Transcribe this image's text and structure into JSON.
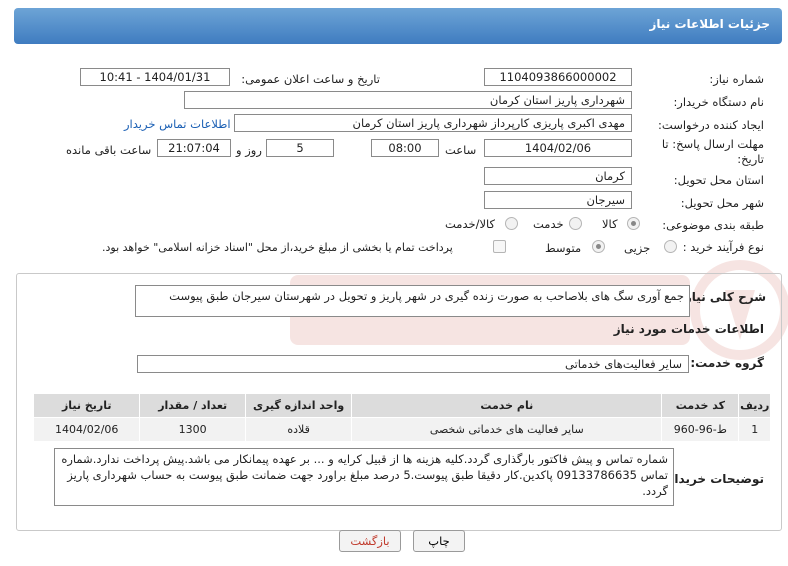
{
  "header": {
    "title": "جزئیات اطلاعات نیاز"
  },
  "form": {
    "need_number_label": "شماره نیاز:",
    "need_number": "1104093866000002",
    "announce_label": "تاریخ و ساعت اعلان عمومی:",
    "announce_value": "1404/01/31 - 10:41",
    "buyer_org_label": "نام دستگاه خریدار:",
    "buyer_org": "شهرداری پاریز استان کرمان",
    "creator_label": "ایجاد کننده درخواست:",
    "creator": "مهدی اکبری پاریزی کارپرداز شهرداری پاریز استان کرمان",
    "contact_link": "اطلاعات تماس خریدار",
    "deadline_label": "مهلت ارسال پاسخ: تا تاریخ:",
    "deadline_date": "1404/02/06",
    "time_label": "ساعت",
    "deadline_time": "08:00",
    "days_value": "5",
    "days_label": "روز و",
    "remaining_time": "21:07:04",
    "remaining_label": "ساعت باقی مانده",
    "province_label": "استان محل تحویل:",
    "province": "کرمان",
    "city_label": "شهر محل تحویل:",
    "city": "سیرجان",
    "category_label": "طبقه بندی موضوعی:",
    "category_options": [
      "کالا",
      "خدمت",
      "کالا/خدمت"
    ],
    "process_label": "نوع فرآیند خرید :",
    "process_options": [
      "جزیی",
      "متوسط"
    ],
    "payment_note": "پرداخت تمام یا بخشی از مبلغ خرید،از محل \"اسناد خزانه اسلامی\" خواهد بود."
  },
  "details": {
    "summary_label": "شرح کلی نیاز:",
    "summary": "جمع آوری سگ های بلاصاحب به صورت زنده گیری در شهر پاریز و تحویل در شهرستان سیرجان طبق پیوست",
    "services_title": "اطلاعات خدمات مورد نیاز",
    "service_group_label": "گروه خدمت:",
    "service_group": "سایر فعالیت‌های خدماتی",
    "table": {
      "headers": [
        "ردیف",
        "کد خدمت",
        "نام خدمت",
        "واحد اندازه گیری",
        "تعداد / مقدار",
        "تاریخ نیاز"
      ],
      "rows": [
        [
          "1",
          "ط-96-960",
          "سایر فعالیت های خدماتی شخصی",
          "قلاده",
          "1300",
          "1404/02/06"
        ]
      ]
    },
    "buyer_notes_label": "توضیحات خریدار:",
    "buyer_notes": "شماره تماس و پیش فاکتور بارگذاری گردد.کلیه هزینه ها از قبیل کرایه و ... بر عهده پیمانکار می باشد.پیش پرداخت ندارد.شماره تماس 09133786635 پاکدین.کار دقیقا طبق پیوست.5 درصد مبلغ براورد جهت ضمانت طبق پیوست به حساب شهرداری پاریز گردد."
  },
  "buttons": {
    "print": "چاپ",
    "back": "بازگشت"
  },
  "colors": {
    "header": "#3f7cc0",
    "link": "#1a5fb4",
    "back_text": "#c0392b"
  }
}
